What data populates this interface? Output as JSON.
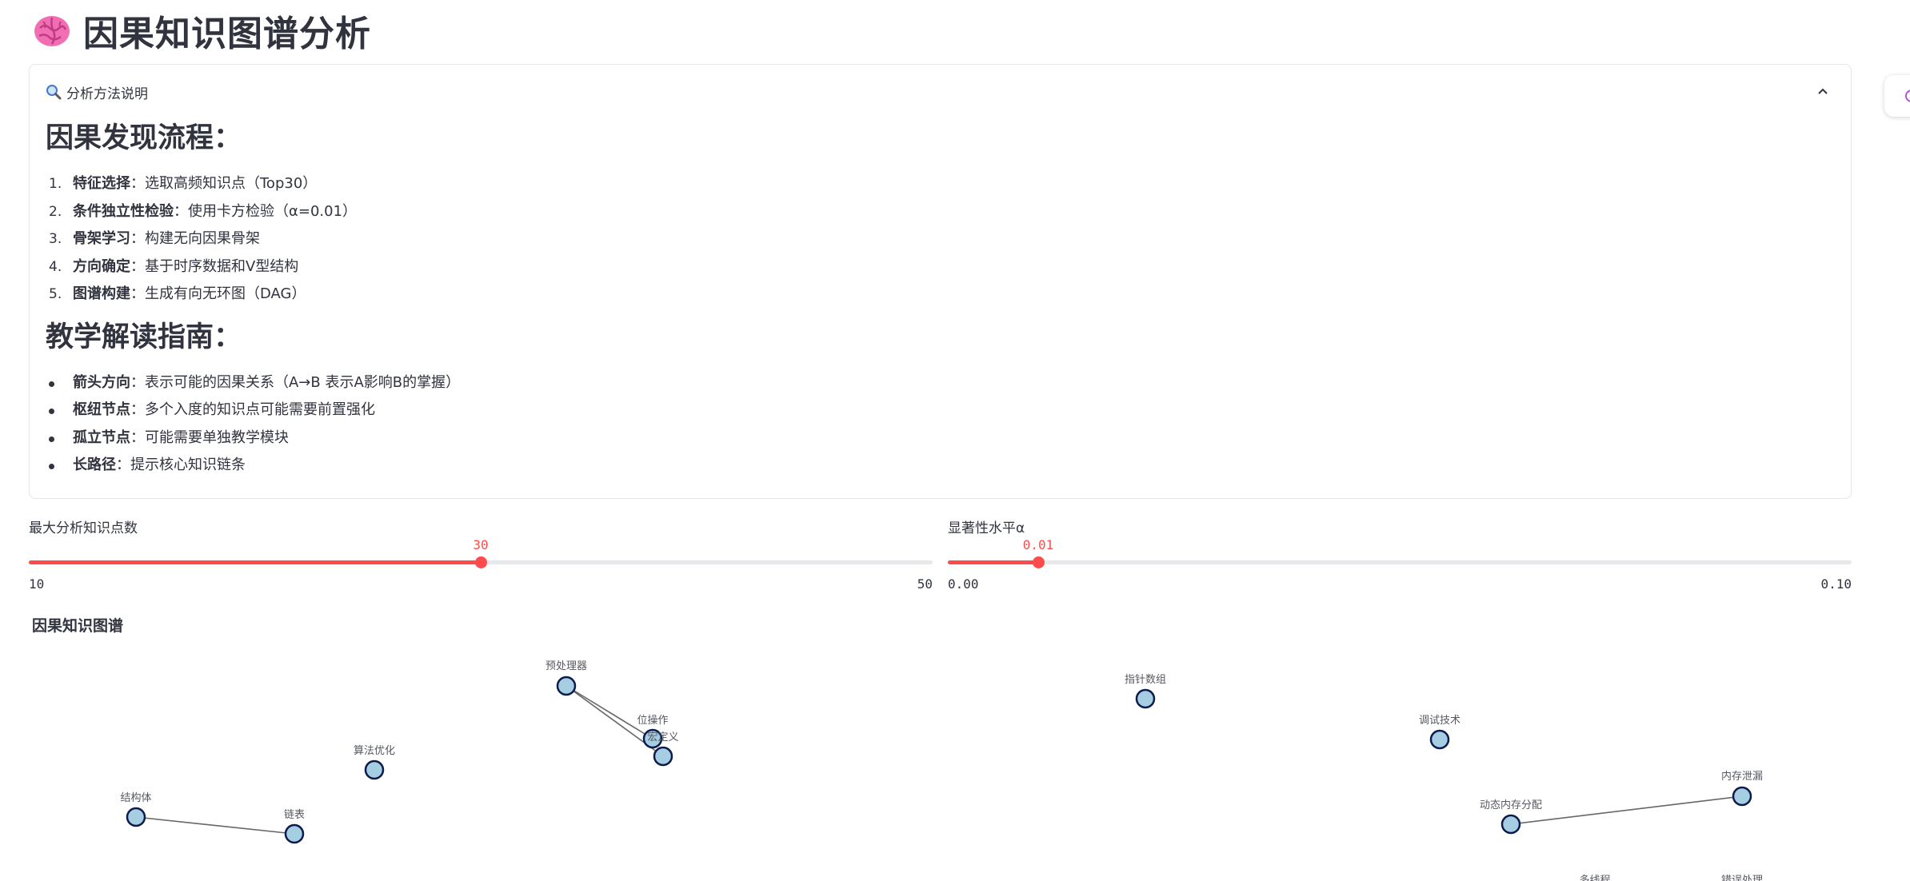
{
  "page": {
    "title": "因果知识图谱分析",
    "title_icon": "brain-icon"
  },
  "expander": {
    "label": "分析方法说明",
    "icon": "magnifier-icon",
    "expanded": true,
    "section1_title": "因果发现流程：",
    "steps": [
      {
        "num": "1.",
        "bold": "特征选择",
        "text": "：选取高频知识点（Top30）"
      },
      {
        "num": "2.",
        "bold": "条件独立性检验",
        "text": "：使用卡方检验（α=0.01）"
      },
      {
        "num": "3.",
        "bold": "骨架学习",
        "text": "：构建无向因果骨架"
      },
      {
        "num": "4.",
        "bold": "方向确定",
        "text": "：基于时序数据和V型结构"
      },
      {
        "num": "5.",
        "bold": "图谱构建",
        "text": "：生成有向无环图（DAG）"
      }
    ],
    "section2_title": "教学解读指南：",
    "guide": [
      {
        "bold": "箭头方向",
        "text": "：表示可能的因果关系（A→B 表示A影响B的掌握）"
      },
      {
        "bold": "枢纽节点",
        "text": "：多个入度的知识点可能需要前置强化"
      },
      {
        "bold": "孤立节点",
        "text": "：可能需要单独教学模块"
      },
      {
        "bold": "长路径",
        "text": "：提示核心知识链条"
      }
    ]
  },
  "sliders": {
    "max_points": {
      "label": "最大分析知识点数",
      "value": "30",
      "min": "10",
      "max": "50",
      "fraction": 0.5
    },
    "alpha": {
      "label": "显著性水平α",
      "value": "0.01",
      "min": "0.00",
      "max": "0.10",
      "fraction": 0.1
    }
  },
  "graph": {
    "title": "因果知识图谱",
    "node_color": "#a6cee3",
    "node_border": "#0d1b4c",
    "edge_color": "#666666",
    "nodes": {
      "preprocessor": "预处理器",
      "bitop": "位操作",
      "macro": "宏定义",
      "algo": "算法优化",
      "struct": "结构体",
      "linkedlist": "链表",
      "ptrarray": "指针数组",
      "debug": "调试技术",
      "memleak": "内存泄漏",
      "dynalloc": "动态内存分配",
      "thread": "多线程",
      "errhandle": "错误处理"
    }
  }
}
